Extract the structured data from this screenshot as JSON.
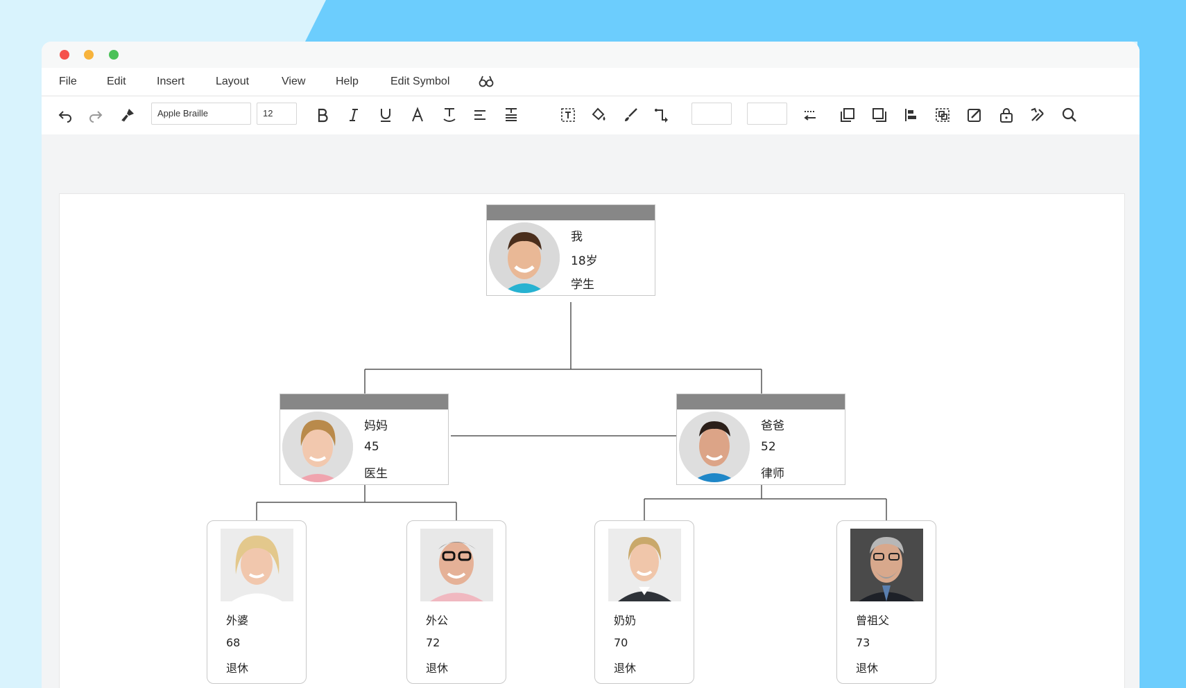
{
  "app": {
    "menu": [
      "File",
      "Edit",
      "Insert",
      "Layout",
      "View",
      "Help",
      "Edit Symbol"
    ],
    "toolbar": {
      "font_name": "Apple Braille",
      "font_size": "12"
    }
  },
  "colors": {
    "accent_blue": "#6ccdfd",
    "card_header": "#878787",
    "connector": "#555555"
  },
  "tree": {
    "root": {
      "name": "我",
      "age": "18岁",
      "job": "学生"
    },
    "mother": {
      "name": "妈妈",
      "age": "45",
      "job": "医生"
    },
    "father": {
      "name": "爸爸",
      "age": "52",
      "job": "律师"
    },
    "grandparents": [
      {
        "name": "外婆",
        "age": "68",
        "job": "退休"
      },
      {
        "name": "外公",
        "age": "72",
        "job": "退休"
      },
      {
        "name": "奶奶",
        "age": "70",
        "job": "退休"
      },
      {
        "name": "曾祖父",
        "age": "73",
        "job": "退休"
      }
    ]
  }
}
